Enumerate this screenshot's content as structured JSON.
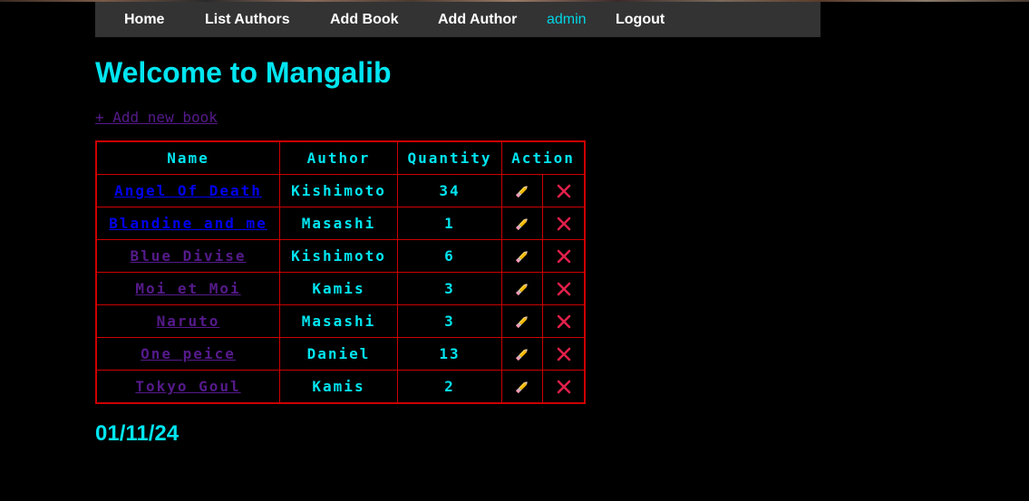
{
  "nav": {
    "home": "Home",
    "list_authors": "List Authors",
    "add_book": "Add Book",
    "add_author": "Add Author",
    "user": "admin",
    "logout": "Logout"
  },
  "page_title": "Welcome to Mangalib",
  "add_new_book": "+ Add new book",
  "table": {
    "headers": [
      "Name",
      "Author",
      "Quantity",
      "Action"
    ],
    "rows": [
      {
        "name": "Angel Of Death",
        "author": "Kishimoto",
        "quantity": "34",
        "link_visited": false
      },
      {
        "name": "Blandine and me",
        "author": "Masashi",
        "quantity": "1",
        "link_visited": false
      },
      {
        "name": "Blue Divise",
        "author": "Kishimoto",
        "quantity": "6",
        "link_visited": true
      },
      {
        "name": "Moi et Moi",
        "author": "Kamis",
        "quantity": "3",
        "link_visited": true
      },
      {
        "name": "Naruto",
        "author": "Masashi",
        "quantity": "3",
        "link_visited": true
      },
      {
        "name": "One peice",
        "author": "Daniel",
        "quantity": "13",
        "link_visited": true
      },
      {
        "name": "Tokyo Goul",
        "author": "Kamis",
        "quantity": "2",
        "link_visited": true
      }
    ],
    "edit_icon": "pencil-icon",
    "delete_icon": "cross-icon"
  },
  "date": "01/11/24",
  "colors": {
    "accent": "#00e5f0",
    "table_border": "#cc0000",
    "link": "#0000ee",
    "link_visited": "#551a8b",
    "navbar": "#333333",
    "background": "#000000"
  }
}
